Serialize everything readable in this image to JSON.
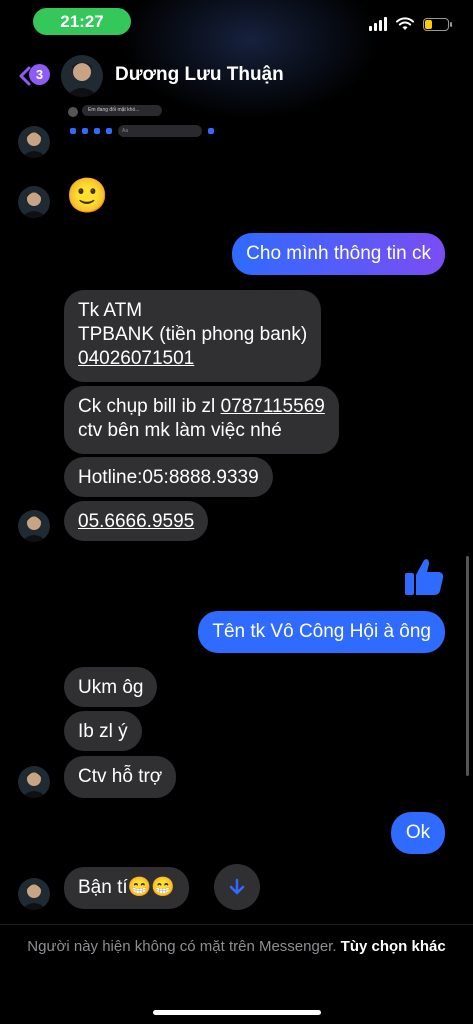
{
  "status": {
    "time": "21:27"
  },
  "header": {
    "back_badge": "3",
    "contact_name": "Dương Lưu Thuận"
  },
  "preview": {
    "text": "Em đang đối mặt khó...",
    "input_placeholder": "Aa"
  },
  "messages": {
    "out1": "Cho mình thông tin ck",
    "in1_line1": "Tk ATM",
    "in1_line2": "TPBANK (tiền phong bank)",
    "in1_line3": "04026071501",
    "in2_line1_prefix": "Ck chụp bill ib zl ",
    "in2_line1_number": "0787115569",
    "in2_line2": "ctv bên mk làm việc nhé",
    "in3": "Hotline:05:8888.9339",
    "in4": "05.6666.9595",
    "out2": "Tên tk Vô Công Hội à ông",
    "in5": "Ukm ôg",
    "in6": "Ib zl ý",
    "in7": "Ctv hỗ trợ",
    "out3": "Ok",
    "in8": "Bận tí😁😁",
    "emoji_reaction": "🙂"
  },
  "footer": {
    "text": "Người này hiện không có mặt trên Messenger. ",
    "option": "Tùy chọn khác"
  },
  "colors": {
    "accent": "#2f6bff",
    "badge": "#8b5cf6",
    "incoming_bubble": "#303033",
    "status_pill": "#34c759"
  }
}
